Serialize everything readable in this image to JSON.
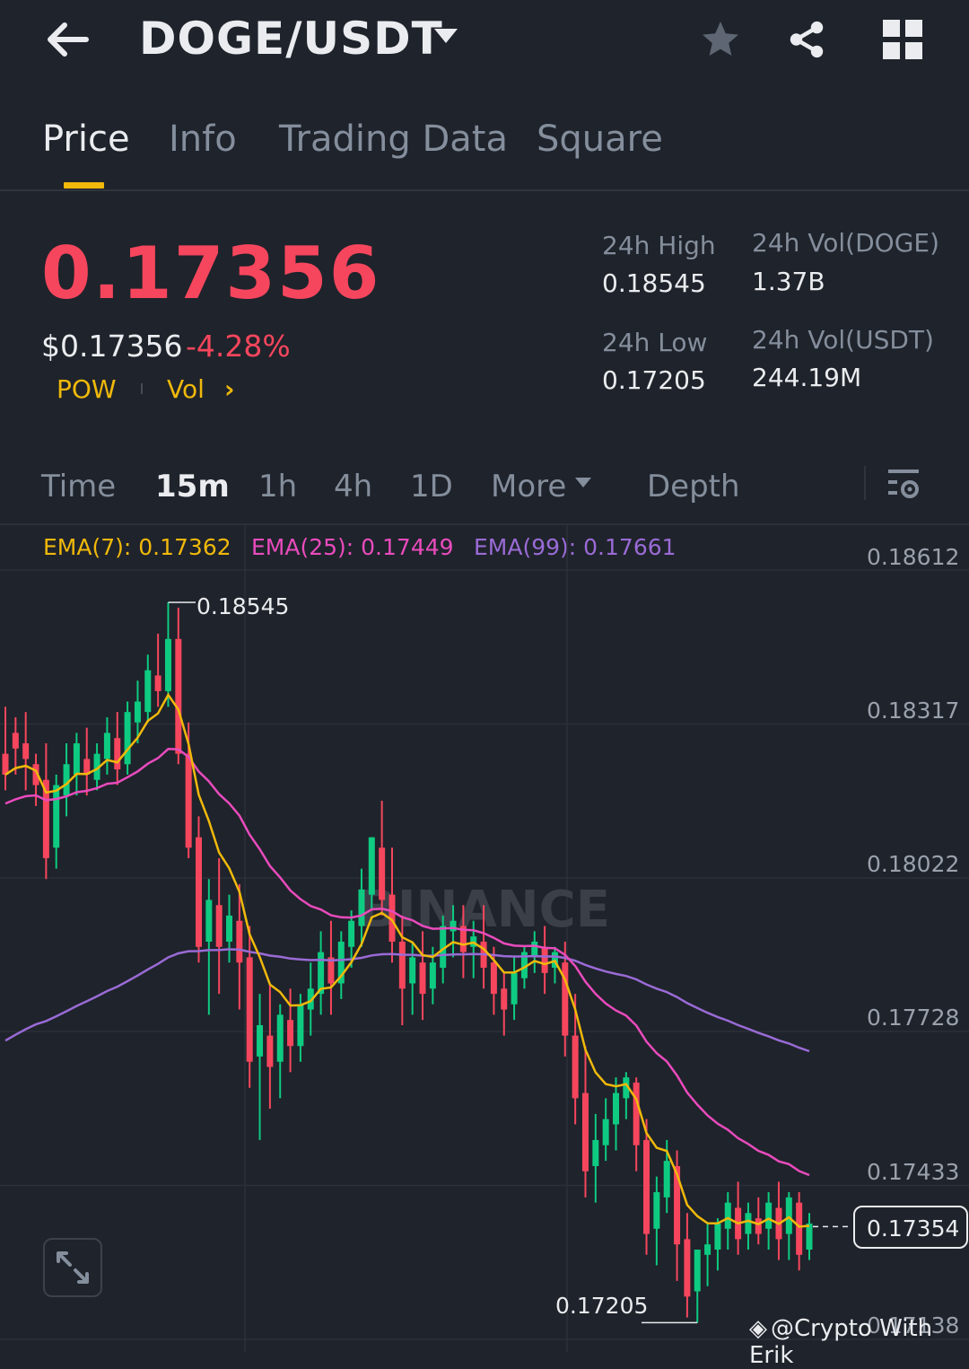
{
  "header": {
    "pair": "DOGE/USDT",
    "back_icon": "arrow-left-icon",
    "favorite_icon": "star-icon",
    "share_icon": "share-icon",
    "grid_icon": "grid-icon"
  },
  "tabs": [
    {
      "label": "Price",
      "active": true
    },
    {
      "label": "Info",
      "active": false
    },
    {
      "label": "Trading Data",
      "active": false
    },
    {
      "label": "Square",
      "active": false
    }
  ],
  "price": {
    "last": "0.17356",
    "usd": "$0.17356",
    "change": "-4.28%",
    "tag_pow": "POW",
    "tag_vol": "Vol",
    "tag_chevron": "›"
  },
  "stats": {
    "high_label": "24h High",
    "high_value": "0.18545",
    "low_label": "24h Low",
    "low_value": "0.17205",
    "vol_doge_label": "24h Vol(DOGE)",
    "vol_doge_value": "1.37B",
    "vol_usdt_label": "24h Vol(USDT)",
    "vol_usdt_value": "244.19M"
  },
  "intervals": [
    {
      "label": "Time",
      "active": false
    },
    {
      "label": "15m",
      "active": true
    },
    {
      "label": "1h",
      "active": false
    },
    {
      "label": "4h",
      "active": false
    },
    {
      "label": "1D",
      "active": false
    },
    {
      "label": "More",
      "active": false
    },
    {
      "label": "Depth",
      "active": false
    }
  ],
  "ema": {
    "ema7": "EMA(7): 0.17362",
    "ema25": "EMA(25): 0.17449",
    "ema99": "EMA(99): 0.17661"
  },
  "colors": {
    "up": "#0ecb81",
    "down": "#f6465d",
    "ema7": "#f0b90b",
    "ema25": "#e94bbd",
    "ema99": "#9a6bd6",
    "accent": "#f0b90b"
  },
  "chart_data": {
    "type": "candlestick",
    "y_axis_labels": [
      "0.18612",
      "0.18317",
      "0.18022",
      "0.17728",
      "0.17433",
      "0.17138"
    ],
    "ylim": [
      0.17138,
      0.18612
    ],
    "max_marker": "0.18545",
    "min_marker": "0.17205",
    "current_price_marker": "0.17354",
    "watermark": "BINANCE",
    "candles": [
      [
        0.1826,
        0.1835,
        0.1822,
        0.1819
      ],
      [
        0.183,
        0.1833,
        0.1827,
        0.1822
      ],
      [
        0.1828,
        0.1834,
        0.1825,
        0.1819
      ],
      [
        0.1824,
        0.1826,
        0.182,
        0.1816
      ],
      [
        0.1821,
        0.1828,
        0.1806,
        0.1802
      ],
      [
        0.1808,
        0.1822,
        0.182,
        0.1804
      ],
      [
        0.1818,
        0.1828,
        0.1824,
        0.1814
      ],
      [
        0.1822,
        0.183,
        0.1828,
        0.1818
      ],
      [
        0.1825,
        0.1831,
        0.1822,
        0.1818
      ],
      [
        0.1821,
        0.1828,
        0.1826,
        0.1819
      ],
      [
        0.1825,
        0.1833,
        0.183,
        0.1822
      ],
      [
        0.1829,
        0.1834,
        0.1823,
        0.182
      ],
      [
        0.1824,
        0.1836,
        0.1834,
        0.1822
      ],
      [
        0.1832,
        0.184,
        0.1836,
        0.1828
      ],
      [
        0.1834,
        0.1845,
        0.1842,
        0.1832
      ],
      [
        0.1841,
        0.1849,
        0.1838,
        0.1835
      ],
      [
        0.1838,
        0.1855,
        0.1848,
        0.1835
      ],
      [
        0.1848,
        0.1854,
        0.1826,
        0.1824
      ],
      [
        0.1826,
        0.1832,
        0.1808,
        0.1806
      ],
      [
        0.181,
        0.1814,
        0.1789,
        0.1786
      ],
      [
        0.179,
        0.1802,
        0.1798,
        0.1776
      ],
      [
        0.1797,
        0.1806,
        0.1789,
        0.178
      ],
      [
        0.179,
        0.1799,
        0.1795,
        0.1786
      ],
      [
        0.1794,
        0.1801,
        0.1786,
        0.1777
      ],
      [
        0.1787,
        0.1793,
        0.1767,
        0.1762
      ],
      [
        0.1768,
        0.178,
        0.1774,
        0.1752
      ],
      [
        0.1772,
        0.1782,
        0.1766,
        0.1758
      ],
      [
        0.1767,
        0.1778,
        0.1776,
        0.176
      ],
      [
        0.1775,
        0.1781,
        0.177,
        0.1765
      ],
      [
        0.177,
        0.178,
        0.1778,
        0.1767
      ],
      [
        0.1777,
        0.1786,
        0.1781,
        0.1772
      ],
      [
        0.178,
        0.1792,
        0.1788,
        0.1776
      ],
      [
        0.1787,
        0.1794,
        0.1782,
        0.1776
      ],
      [
        0.1782,
        0.1792,
        0.179,
        0.1779
      ],
      [
        0.1789,
        0.1796,
        0.1794,
        0.1785
      ],
      [
        0.1793,
        0.1804,
        0.18,
        0.1789
      ],
      [
        0.1799,
        0.1808,
        0.181,
        0.1796
      ],
      [
        0.1808,
        0.1817,
        0.1798,
        0.1795
      ],
      [
        0.1799,
        0.1808,
        0.179,
        0.1786
      ],
      [
        0.179,
        0.1795,
        0.1781,
        0.1774
      ],
      [
        0.1782,
        0.179,
        0.1787,
        0.1776
      ],
      [
        0.1786,
        0.1792,
        0.178,
        0.1775
      ],
      [
        0.1781,
        0.1789,
        0.1786,
        0.1778
      ],
      [
        0.1785,
        0.1795,
        0.1793,
        0.1782
      ],
      [
        0.1792,
        0.1797,
        0.1794,
        0.1787
      ],
      [
        0.1793,
        0.1797,
        0.1788,
        0.1783
      ],
      [
        0.1789,
        0.1794,
        0.1791,
        0.1783
      ],
      [
        0.179,
        0.1797,
        0.1785,
        0.1781
      ],
      [
        0.1786,
        0.1789,
        0.178,
        0.1776
      ],
      [
        0.1781,
        0.1784,
        0.1777,
        0.1772
      ],
      [
        0.1778,
        0.1787,
        0.1784,
        0.1775
      ],
      [
        0.1783,
        0.1789,
        0.1788,
        0.1781
      ],
      [
        0.1787,
        0.1792,
        0.179,
        0.1784
      ],
      [
        0.1789,
        0.1793,
        0.1784,
        0.178
      ],
      [
        0.1785,
        0.1789,
        0.1788,
        0.1782
      ],
      [
        0.1786,
        0.179,
        0.1772,
        0.1768
      ],
      [
        0.1772,
        0.178,
        0.176,
        0.1755
      ],
      [
        0.1761,
        0.177,
        0.1746,
        0.1741
      ],
      [
        0.1747,
        0.1757,
        0.1752,
        0.174
      ],
      [
        0.1751,
        0.176,
        0.1756,
        0.1748
      ],
      [
        0.1755,
        0.1764,
        0.1761,
        0.175
      ],
      [
        0.176,
        0.1765,
        0.1764,
        0.1756
      ],
      [
        0.1763,
        0.1764,
        0.1751,
        0.1746
      ],
      [
        0.1752,
        0.1756,
        0.1734,
        0.173
      ],
      [
        0.1735,
        0.1745,
        0.1742,
        0.1728
      ],
      [
        0.1741,
        0.1752,
        0.1748,
        0.1738
      ],
      [
        0.1747,
        0.175,
        0.1732,
        0.1725
      ],
      [
        0.1733,
        0.1738,
        0.1722,
        0.1718
      ],
      [
        0.1723,
        0.173,
        0.1731,
        0.1717
      ],
      [
        0.173,
        0.1736,
        0.1732,
        0.1724
      ],
      [
        0.1731,
        0.1737,
        0.1736,
        0.1727
      ],
      [
        0.1735,
        0.1742,
        0.174,
        0.1731
      ],
      [
        0.1739,
        0.1744,
        0.1733,
        0.173
      ],
      [
        0.1734,
        0.174,
        0.1738,
        0.1731
      ],
      [
        0.1737,
        0.1741,
        0.1734,
        0.1732
      ],
      [
        0.1735,
        0.1742,
        0.174,
        0.1731
      ],
      [
        0.1739,
        0.1744,
        0.1733,
        0.1729
      ],
      [
        0.1734,
        0.1742,
        0.1741,
        0.1729
      ],
      [
        0.174,
        0.1742,
        0.173,
        0.1727
      ],
      [
        0.1731,
        0.1738,
        0.1736,
        0.1729
      ]
    ]
  },
  "watermark_text": "@Crypto With Erik"
}
